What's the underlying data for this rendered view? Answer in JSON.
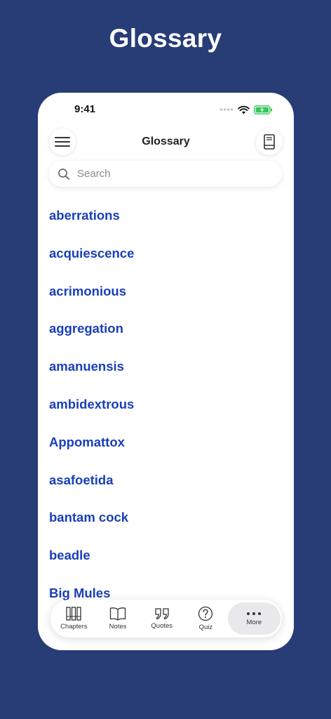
{
  "page_heading": "Glossary",
  "status_bar": {
    "time": "9:41"
  },
  "header": {
    "title": "Glossary"
  },
  "search": {
    "placeholder": "Search"
  },
  "terms": [
    "aberrations",
    "acquiescence",
    "acrimonious",
    "aggregation",
    "amanuensis",
    "ambidextrous",
    "Appomattox",
    "asafoetida",
    "bantam cock",
    "beadle",
    "Big Mules"
  ],
  "tab_bar": {
    "tabs": [
      {
        "label": "Chapters",
        "icon": "books-icon"
      },
      {
        "label": "Notes",
        "icon": "open-book-icon"
      },
      {
        "label": "Quotes",
        "icon": "quote-icon"
      },
      {
        "label": "Quiz",
        "icon": "question-icon"
      },
      {
        "label": "More",
        "icon": "more-icon",
        "active": true
      }
    ]
  },
  "colors": {
    "background": "#283c76",
    "term_link": "#1a3fb8",
    "battery": "#34c759"
  }
}
